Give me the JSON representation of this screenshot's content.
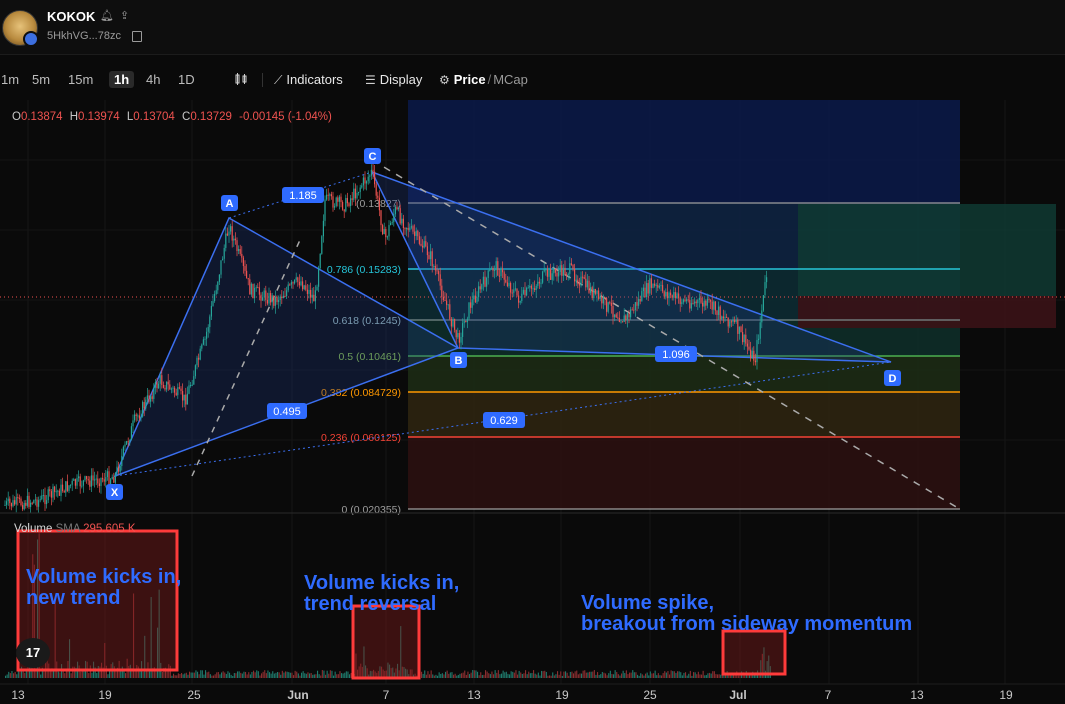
{
  "header": {
    "token_name": "KOKOK",
    "address": "5HkhVG...78zc",
    "icons": [
      "bell-icon",
      "share-icon",
      "copy-icon"
    ]
  },
  "toolbar": {
    "timeframes": [
      "1m",
      "5m",
      "15m",
      "1h",
      "4h",
      "1D"
    ],
    "active_timeframe": "1h",
    "indicators_label": "Indicators",
    "display_label": "Display",
    "price_label": "Price",
    "separator": "/",
    "mcap_label": "MCap"
  },
  "ohlc": {
    "o_label": "O",
    "o": "0.13874",
    "h_label": "H",
    "h": "0.13974",
    "l_label": "L",
    "l": "0.13704",
    "c_label": "C",
    "c": "0.13729",
    "change": "-0.00145 (-1.04%)"
  },
  "volume_legend": {
    "label": "Volume",
    "sma_label": "SMA",
    "sma_value": "295.605 K"
  },
  "pattern_points": {
    "X": "X",
    "A": "A",
    "B": "B",
    "C": "C",
    "D": "D"
  },
  "ratios": {
    "xa_ab": "0.495",
    "ab_bc": "1.185",
    "bc_cd": "1.096",
    "xa_ad": "0.629"
  },
  "fib_levels": [
    {
      "label": "(0.13827)",
      "color": "#9e9e9e"
    },
    {
      "label": "0.786 (0.15283)",
      "color": "#26c6da"
    },
    {
      "label": "0.618 (0.1245)",
      "color": "#9e9e9e"
    },
    {
      "label": "0.5 (0.10461)",
      "color": "#4caf50"
    },
    {
      "label": "0.382 (0.084729)",
      "color": "#ff9800"
    },
    {
      "label": "0.236 (0.060125)",
      "color": "#f44336"
    },
    {
      "label": "0 (0.020355)",
      "color": "#9e9e9e"
    }
  ],
  "x_axis_labels": [
    "13",
    "19",
    "25",
    "Jun",
    "7",
    "13",
    "19",
    "25",
    "Jul",
    "7",
    "13",
    "19"
  ],
  "annotations": {
    "first": "Volume kicks in,\nnew trend",
    "second": "Volume kicks in,\ntrend reversal",
    "third": "Volume spike,\nbreakout from sideway momentum"
  },
  "tv_logo": "17",
  "colors": {
    "accent": "#2f6bff",
    "pattern_line": "#3b6ff0",
    "up": "#26a69a",
    "down": "#ef5350",
    "highlight_box": "#ff3b3b"
  }
}
